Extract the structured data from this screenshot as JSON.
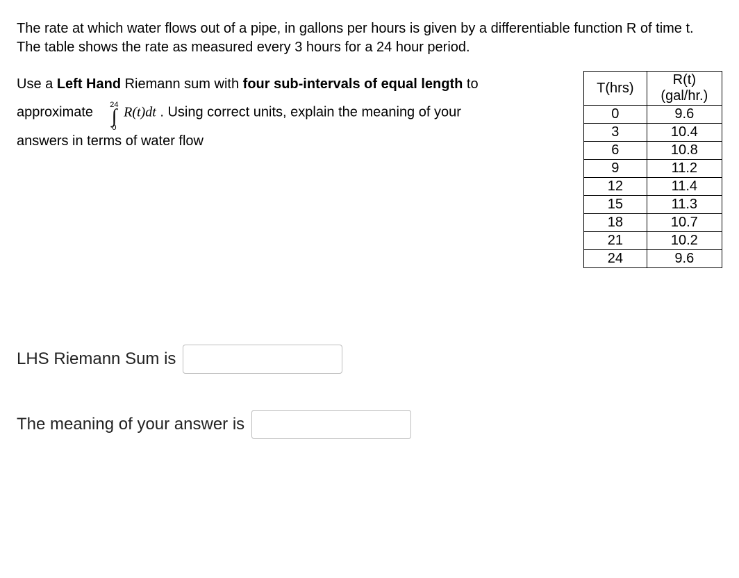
{
  "intro": "The rate at which water flows out of a pipe, in gallons per hours is given by a differentiable function R of time t.  The table shows the rate as measured every 3 hours for a 24 hour period.",
  "prompt": {
    "part1_pre": "Use a ",
    "part1_bold": "Left Hand",
    "part1_mid": " Riemann sum with ",
    "part1_bold2": "four sub-intervals of equal length",
    "part1_end": " to",
    "part2_pre": "approximate",
    "integral_upper": "24",
    "integral_lower": "0",
    "integral_expr": "R(t)dt",
    "part2_post": ".  Using correct units, explain the meaning of your",
    "part3": "answers in terms of water flow"
  },
  "table": {
    "headers": [
      "T(hrs)",
      "R(t)\n(gal/hr.)"
    ],
    "rows": [
      [
        "0",
        "9.6"
      ],
      [
        "3",
        "10.4"
      ],
      [
        "6",
        "10.8"
      ],
      [
        "9",
        "11.2"
      ],
      [
        "12",
        "11.4"
      ],
      [
        "15",
        "11.3"
      ],
      [
        "18",
        "10.7"
      ],
      [
        "21",
        "10.2"
      ],
      [
        "24",
        "9.6"
      ]
    ]
  },
  "answers": {
    "label1": "LHS Riemann Sum is",
    "label2": "The meaning of your answer is"
  }
}
